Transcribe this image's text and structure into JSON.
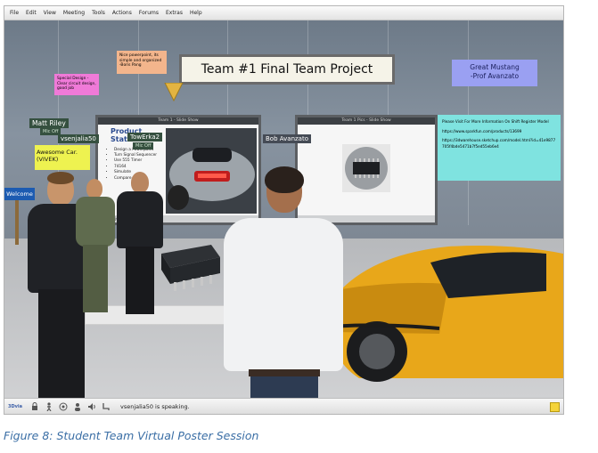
{
  "menu": [
    "File",
    "Edit",
    "View",
    "Meeting",
    "Tools",
    "Actions",
    "Forums",
    "Extras",
    "Help"
  ],
  "signs": {
    "main_title": "Team #1 Final Team Project",
    "mustang_line1": "Great Mustang",
    "mustang_line2": "-Prof Avanzato",
    "welcome": "Welcome"
  },
  "notes": {
    "pink": "Special Design - Clear circuit design, good job",
    "orange": "Nice powerpoint, its simple and organized -Boris Pang",
    "info_lines": [
      "Please Visit For More Information On Shift Register Model",
      "https://www.sparkfun.com/products/13699",
      "https://3dwarehouse.sketchup.com/model.html?id=41e9877705f4bde5471b7f5ed55eb6e4"
    ]
  },
  "boards": {
    "left_title": "Team 1 - Slide Show",
    "left_slide_heading": "Product Statement",
    "left_bullets": [
      "Design a Powerpoint",
      "Turn Signal Sequencer",
      "Use 555 Timer",
      "74164",
      "Simulate",
      "Compare"
    ],
    "left_footer": "ETS Project page 001 (1 / 8)",
    "right_title": "Team 1 Pics - Slide Show"
  },
  "name_tags": {
    "matt": "Matt Riley",
    "matt_mic": "Mic Off",
    "vsenjalia": "vsenjalia50",
    "awesome": "Awesome Car. (VIVEK)",
    "towerka": "TowErka2",
    "towerka_mic": "Mic Off",
    "bob": "Bob Avanzato"
  },
  "status": {
    "logo": "3Dvia",
    "speaking": "vsenjalia50 is speaking."
  },
  "caption": "Figure 8: Student Team Virtual Poster Session",
  "colors": {
    "caption": "#3a6ea5",
    "car": "#e8a71a",
    "pink_note": "#f07ad8",
    "orange_note": "#f3b58c",
    "mustang_sign": "#9aa0f2",
    "info_panel": "#7fe3e0",
    "tag_green": "#35503f"
  }
}
